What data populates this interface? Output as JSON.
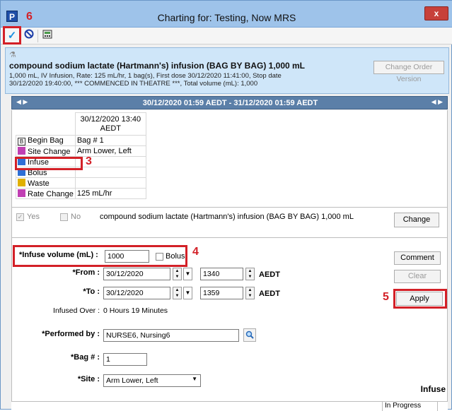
{
  "window": {
    "title": "Charting for: Testing, Now  MRS",
    "close_glyph": "x",
    "app_icon_letter": "P"
  },
  "toolbar": {
    "items": [
      "check-icon",
      "cancel-icon",
      "calculator-icon"
    ]
  },
  "order": {
    "title": "compound sodium lactate (Hartmann's) infusion (BAG BY BAG) 1,000 mL",
    "detail_line1": "1,000 mL, IV Infusion, Rate: 125 mL/hr, 1 bag(s), First dose 30/12/2020 11:41:00, Stop date",
    "detail_line2": "30/12/2020 19:40:00, *** COMMENCED IN THEATRE ***, Total volume (mL): 1,000",
    "change_order_version_label": "Change Order Version"
  },
  "navbar": {
    "range": "30/12/2020 01:59 AEDT - 31/12/2020 01:59 AEDT"
  },
  "grid": {
    "header_date": "30/12/2020 13:40",
    "header_tz": "AEDT",
    "rows": [
      {
        "label": "Begin Bag",
        "value": "Bag # 1",
        "icon": "begin-bag-icon",
        "color": "#3a3a3a"
      },
      {
        "label": "Site Change",
        "value": "Arm Lower, Left",
        "icon": "site-change-icon",
        "color": "#c03fb3"
      },
      {
        "label": "Infuse",
        "value": "",
        "icon": "infuse-icon",
        "color": "#2e6fd6"
      },
      {
        "label": "Bolus",
        "value": "",
        "icon": "bolus-icon",
        "color": "#2e6fd6"
      },
      {
        "label": "Waste",
        "value": "",
        "icon": "waste-icon",
        "color": "#e0b000"
      },
      {
        "label": "Rate Change",
        "value": "125 mL/hr",
        "icon": "rate-change-icon",
        "color": "#c03fb3"
      }
    ]
  },
  "confirm": {
    "yes_label": "Yes",
    "no_label": "No",
    "order_text": "compound sodium lactate (Hartmann's) infusion (BAG BY BAG) 1,000 mL",
    "change_label": "Change"
  },
  "form": {
    "infuse_volume_label": "*Infuse volume (mL) :",
    "infuse_volume_value": "1000",
    "bolus_label": "Bolus",
    "from_label": "*From :",
    "from_date": "30/12/2020",
    "from_time": "1340",
    "from_tz": "AEDT",
    "to_label": "*To :",
    "to_date": "30/12/2020",
    "to_time": "1359",
    "to_tz": "AEDT",
    "infused_over_label": "Infused Over :",
    "infused_over_value": "0 Hours  19 Minutes",
    "performed_by_label": "*Performed by :",
    "performed_by_value": "NURSE6, Nursing6",
    "bag_label": "*Bag # :",
    "bag_value": "1",
    "site_label": "*Site :",
    "site_value": "Arm Lower, Left",
    "comment_label": "Comment",
    "clear_label": "Clear",
    "apply_label": "Apply",
    "section_title": "Infuse"
  },
  "annotations": {
    "n3": "3",
    "n4": "4",
    "n5": "5",
    "n6": "6"
  },
  "status": {
    "state": "In Progress"
  },
  "colors": {
    "titlebar": "#9ec3ea",
    "order_panel": "#cfe6f9",
    "navbar": "#5b7fa8",
    "annotation_red": "#d32027"
  }
}
